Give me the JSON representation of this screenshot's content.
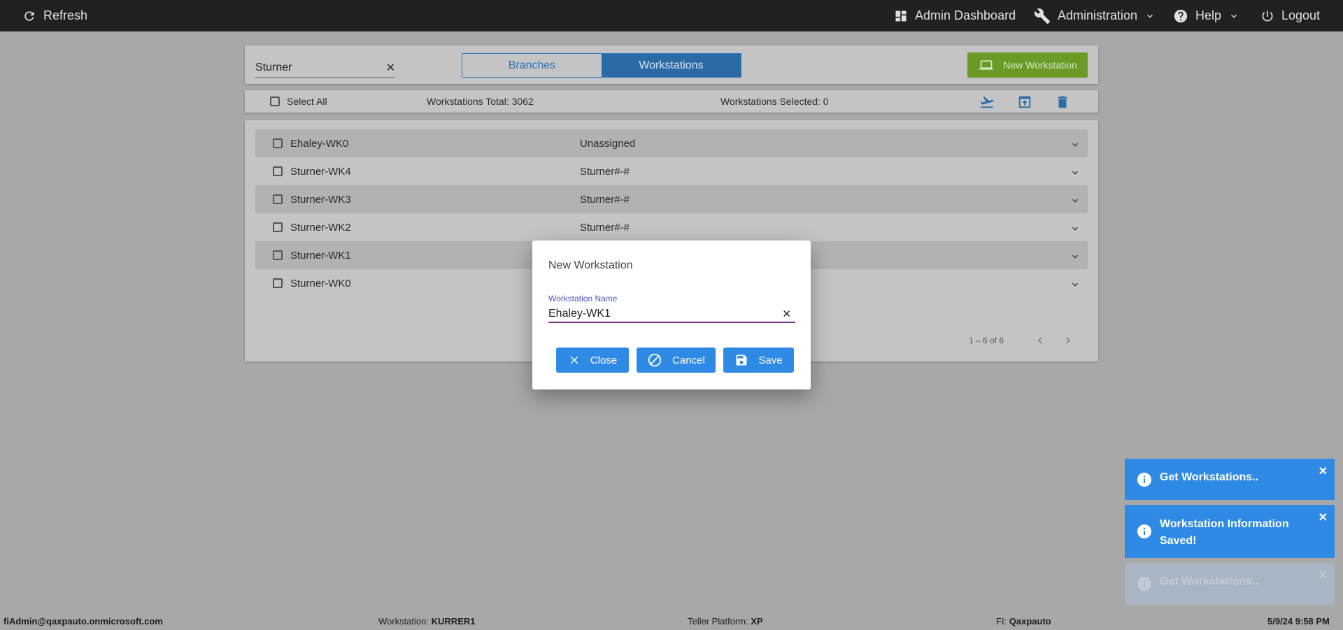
{
  "topbar": {
    "refresh": "Refresh",
    "admin_dashboard": "Admin Dashboard",
    "administration": "Administration",
    "help": "Help",
    "logout": "Logout"
  },
  "search": {
    "value": "Sturner"
  },
  "view_toggle": {
    "branches": "Branches",
    "workstations": "Workstations",
    "active": "Workstations"
  },
  "new_workstation_button": "New Workstation",
  "toolbar": {
    "select_all": "Select All",
    "total": "Workstations Total: 3062",
    "selected": "Workstations Selected: 0"
  },
  "rows": [
    {
      "name": "Ehaley-WK0",
      "branch": "Unassigned"
    },
    {
      "name": "Sturner-WK4",
      "branch": "Sturner#-#"
    },
    {
      "name": "Sturner-WK3",
      "branch": "Sturner#-#"
    },
    {
      "name": "Sturner-WK2",
      "branch": "Sturner#-#"
    },
    {
      "name": "Sturner-WK1",
      "branch": ""
    },
    {
      "name": "Sturner-WK0",
      "branch": ""
    }
  ],
  "pager": {
    "range": "1 – 6 of 6"
  },
  "dialog": {
    "title": "New Workstation",
    "field_label": "Workstation Name",
    "field_value": "Ehaley-WK1",
    "close": "Close",
    "cancel": "Cancel",
    "save": "Save"
  },
  "toasts": [
    {
      "text": "Get Workstations..",
      "color": "#2f8ae5"
    },
    {
      "text": "Workstation Information Saved!",
      "color": "#2f8ae5"
    },
    {
      "text": "Get Workstations..",
      "color": "#a9b9c9"
    }
  ],
  "footer": {
    "user": "fiAdmin@qaxpauto.onmicrosoft.com",
    "workstation_label": "Workstation:",
    "workstation_value": "KURRER1",
    "platform_label": "Teller Platform:",
    "platform_value": "XP",
    "fi_label": "FI:",
    "fi_value": "Qaxpauto",
    "datetime": "5/9/24 9:58 PM"
  },
  "colors": {
    "topbar": "#212121",
    "accent_blue": "#2f8ae5",
    "new_button_green": "#6c9a26",
    "input_underline": "#7b2d8a"
  }
}
